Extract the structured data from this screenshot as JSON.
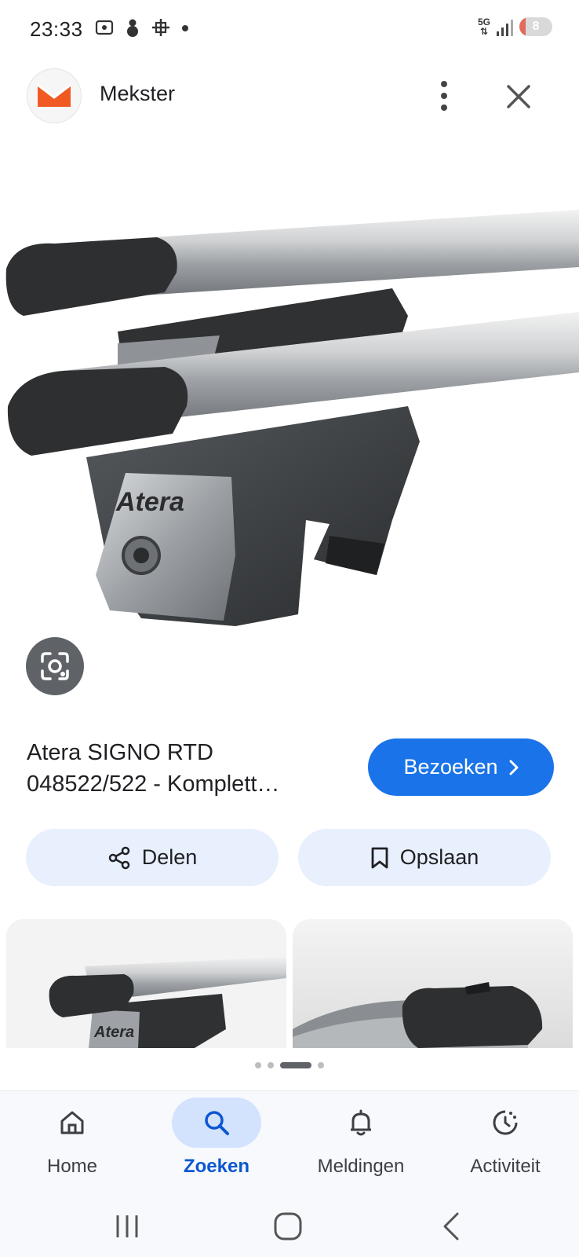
{
  "status_bar": {
    "time": "23:33",
    "left_icons": [
      "screenshot-icon",
      "snowman-icon",
      "crosshair-icon",
      "notification-dot-icon"
    ],
    "network": "5G",
    "battery_level": "8",
    "battery_fraction": 0.08
  },
  "header": {
    "site_name": "Mekster",
    "menu_icon": "more-vert-icon",
    "close_icon": "close-icon"
  },
  "product": {
    "title_line1": "Atera SIGNO RTD",
    "title_line2": "048522/522 - Komplett…",
    "image_brand_text": "Atera"
  },
  "actions": {
    "visit_label": "Bezoeken",
    "share_label": "Delen",
    "save_label": "Opslaan"
  },
  "related": {
    "thumb1_brand_text": "Atera"
  },
  "carousel": {
    "dot_count": 4,
    "active_index": 2
  },
  "bottom_nav": {
    "items": [
      {
        "label": "Home",
        "icon": "home-icon"
      },
      {
        "label": "Zoeken",
        "icon": "search-icon"
      },
      {
        "label": "Meldingen",
        "icon": "bell-icon"
      },
      {
        "label": "Activiteit",
        "icon": "activity-icon"
      }
    ],
    "active": "Zoeken"
  },
  "colors": {
    "accent": "#1a73e8",
    "pill_bg": "#e8f0fe",
    "logo_orange": "#f05a22",
    "active_nav": "#0b57d0"
  }
}
